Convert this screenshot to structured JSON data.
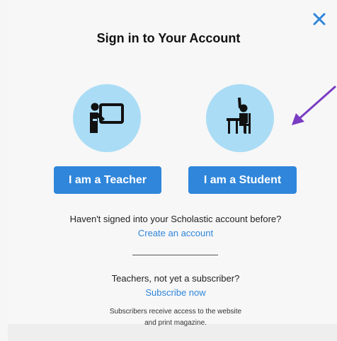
{
  "modal": {
    "title": "Sign in to Your Account",
    "close_icon": "close-icon"
  },
  "roles": {
    "teacher": {
      "label": "I am a Teacher",
      "icon": "teacher-at-board-icon"
    },
    "student": {
      "label": "I am a Student",
      "icon": "student-at-desk-icon"
    }
  },
  "new_account": {
    "prompt": "Haven't signed into your Scholastic account before?",
    "link": "Create an account"
  },
  "subscribe": {
    "prompt": "Teachers, not yet a subscriber?",
    "link": "Subscribe now",
    "note_line1": "Subscribers receive access to the website",
    "note_line2": "and print magazine."
  },
  "colors": {
    "accent": "#2f86db",
    "circle": "#aadcf5",
    "arrow": "#7a3cc2",
    "close": "#2f86db"
  }
}
